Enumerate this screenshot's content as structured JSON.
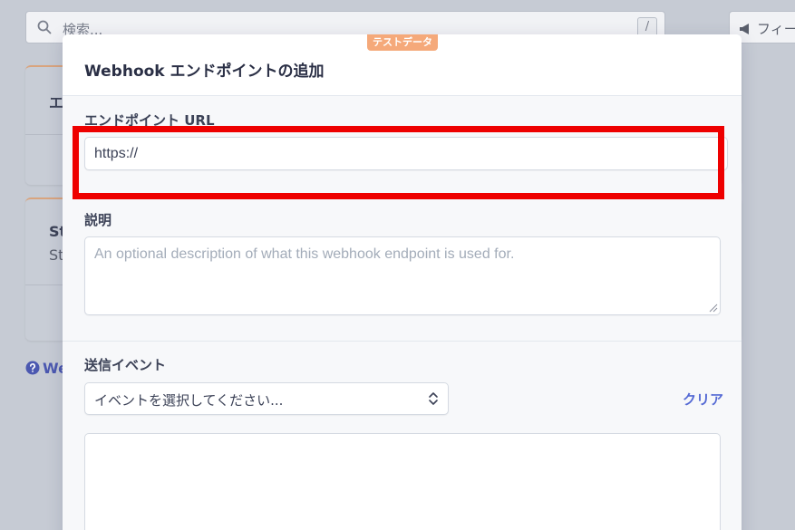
{
  "background": {
    "search_placeholder": "検索...",
    "search_shortcut": "/",
    "search_icon": "search-icon",
    "feedback_label": "フィー",
    "feedback_icon": "megaphone-icon",
    "card1_title": "エ",
    "card2_title": "St",
    "card2_subtitle": "St",
    "help_link": "We",
    "help_icon": "question-circle-icon"
  },
  "modal": {
    "test_badge": "テストデータ",
    "title": "Webhook エンドポイントの追加",
    "url_field": {
      "label": "エンドポイント URL",
      "value": "https://"
    },
    "description_field": {
      "label": "説明",
      "placeholder": "An optional description of what this webhook endpoint is used for."
    },
    "events_field": {
      "label": "送信イベント",
      "select_value": "イベントを選択してください...",
      "clear_label": "クリア"
    }
  },
  "highlight": {
    "color": "#ee0000",
    "target": "url_field"
  },
  "colors": {
    "accent": "#5469d4",
    "badge": "#f5a97a"
  }
}
